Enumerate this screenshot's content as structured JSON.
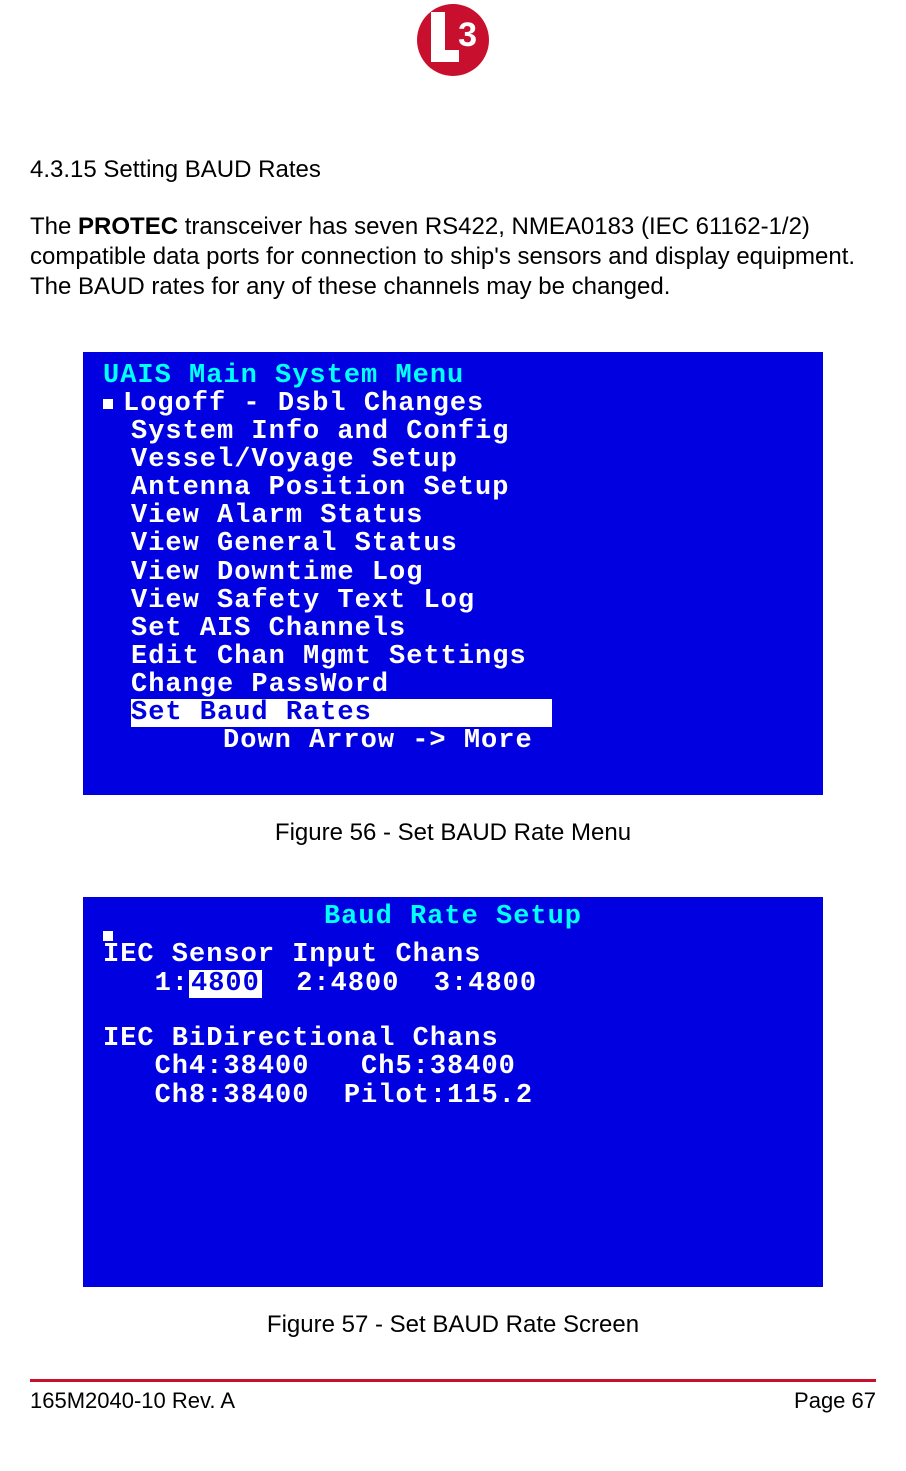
{
  "logo": {
    "text3": "3"
  },
  "section": {
    "num": "4.3.15",
    "title": "Setting BAUD Rates"
  },
  "para": {
    "pre": "The ",
    "brand": "PROTEC",
    "post": " transceiver has seven RS422, NMEA0183 (IEC 61162-1/2) compatible data ports for connection to ship's sensors and display equipment. The BAUD rates for any of these channels may be changed."
  },
  "screen1": {
    "title": "UAIS Main System Menu",
    "items": [
      "Logoff - Dsbl Changes",
      "System Info and Config",
      "Vessel/Voyage Setup",
      "Antenna Position Setup",
      "View Alarm Status",
      "View General Status",
      "View Downtime Log",
      "View Safety Text Log",
      "Set AIS Channels",
      "Edit Chan Mgmt Settings",
      "Change PassWord"
    ],
    "selected": "Set Baud Rates",
    "more": "Down Arrow -> More"
  },
  "fig56": "Figure 56 - Set BAUD Rate Menu",
  "screen2": {
    "title": "Baud Rate Setup",
    "h1": "IEC Sensor Input Chans",
    "r1": {
      "l1": "1:",
      "v1": "4800",
      "l2": "2:",
      "v2": "4800",
      "l3": "3:",
      "v3": "4800"
    },
    "h2": "IEC BiDirectional Chans",
    "r2a": {
      "l1": "Ch4:",
      "v1": "38400",
      "l2": "Ch5:",
      "v2": "38400"
    },
    "r2b": {
      "l1": "Ch8:",
      "v1": "38400",
      "l2": "Pilot:",
      "v2": "115.2"
    }
  },
  "fig57": "Figure 57 - Set BAUD Rate Screen",
  "footer": {
    "left": "165M2040-10 Rev. A",
    "right": "Page 67"
  }
}
